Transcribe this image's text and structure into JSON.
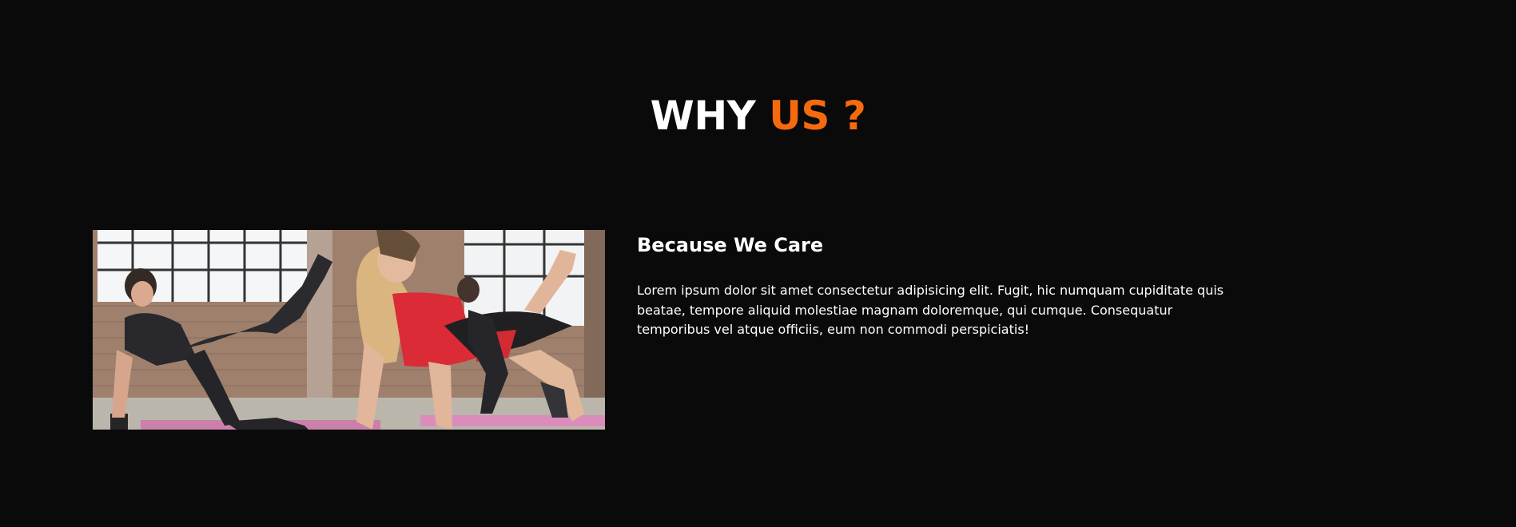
{
  "section": {
    "title_part1": "WHY ",
    "title_part2": "US ?",
    "heading": "Because We Care",
    "paragraph": "Lorem ipsum dolor sit amet consectetur adipisicing elit. Fugit, hic numquam cupiditate quis beatae, tempore aliquid molestiae magnam doloremque, qui cumque. Consequatur temporibus vel atque officiis, eum non commodi perspiciatis!"
  },
  "colors": {
    "background": "#0a0a0a",
    "accent": "#f56a0f",
    "text": "#ffffff"
  },
  "icons": {
    "photo": "fitness-class-photo"
  }
}
